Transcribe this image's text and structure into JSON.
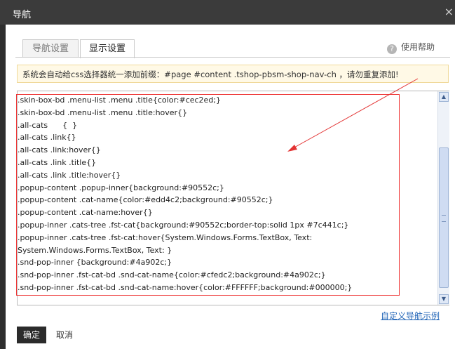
{
  "window": {
    "title": "导航",
    "close_glyph": "×"
  },
  "tabs": [
    {
      "label": "导航设置"
    },
    {
      "label": "显示设置"
    }
  ],
  "help": {
    "label": "使用帮助",
    "icon": "question-icon"
  },
  "notice": {
    "text": "系统会自动给css选择器统一添加前缀：#page #content .tshop-pbsm-shop-nav-ch ，请勿重复添加!"
  },
  "editor": {
    "lines": [
      ".skin-box-bd .menu-list .menu .title{color:#cec2ed;}",
      ".skin-box-bd .menu-list .menu .title:hover{}",
      ".all-cats      {  }",
      ".all-cats .link{}",
      ".all-cats .link:hover{}",
      ".all-cats .link .title{}",
      ".all-cats .link .title:hover{}",
      ".popup-content .popup-inner{background:#90552c;}",
      ".popup-content .cat-name{color:#edd4c2;background:#90552c;}",
      ".popup-content .cat-name:hover{}",
      ".popup-inner .cats-tree .fst-cat{background:#90552c;border-top:solid 1px #7c441c;}",
      ".popup-inner .cats-tree .fst-cat:hover{System.Windows.Forms.TextBox, Text:",
      "System.Windows.Forms.TextBox, Text: }",
      ".snd-pop-inner {background:#4a902c;}",
      ".snd-pop-inner .fst-cat-bd .snd-cat-name{color:#cfedc2;background:#4a902c;}",
      ".snd-pop-inner .fst-cat-bd .snd-cat-name:hover{color:#FFFFFF;background:#000000;}"
    ]
  },
  "example_link": {
    "label": "自定义导航示例"
  },
  "buttons": {
    "ok": "确定",
    "cancel": "取消"
  },
  "colors": {
    "annotation": "#e33333",
    "link": "#2366b8"
  }
}
